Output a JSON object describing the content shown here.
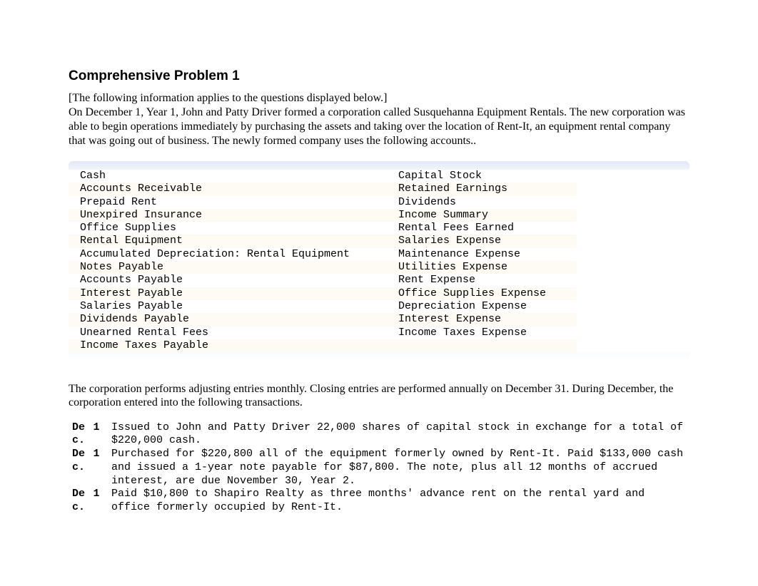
{
  "title": "Comprehensive Problem 1",
  "intro_bracket": "[The following information applies to the questions displayed below.]",
  "intro_body": "On December 1, Year 1, John and Patty Driver formed a corporation called Susquehanna Equipment Rentals. The new corporation was able to begin operations immediately by purchasing the assets and taking over the location of Rent-It, an equipment rental company that was going out of business. The newly formed company uses the following accounts..",
  "accounts": {
    "left": [
      "Cash",
      "Accounts Receivable",
      "Prepaid Rent",
      "Unexpired Insurance",
      "Office Supplies",
      "Rental Equipment",
      "Accumulated Depreciation: Rental Equipment",
      "Notes Payable",
      "Accounts Payable",
      "Interest Payable",
      "Salaries Payable",
      "Dividends Payable",
      "Unearned Rental Fees",
      "Income Taxes Payable"
    ],
    "right": [
      "Capital Stock",
      "Retained Earnings",
      "Dividends",
      "Income Summary",
      "Rental Fees Earned",
      "Salaries Expense",
      "Maintenance Expense",
      "Utilities Expense",
      "Rent Expense",
      "Office Supplies Expense",
      "Depreciation Expense",
      "Interest Expense",
      "Income Taxes Expense",
      ""
    ]
  },
  "mid_paragraph": "The corporation performs adjusting entries monthly. Closing entries are performed annually on December 31. During December, the corporation entered into the following transactions.",
  "transactions": [
    {
      "month_top": "De",
      "month_bottom": "c.",
      "day": "1",
      "desc": "Issued to John and Patty Driver 22,000 shares of capital stock in exchange for a total of $220,000 cash."
    },
    {
      "month_top": "De",
      "month_bottom": "c.",
      "day": "1",
      "desc": "Purchased for $220,800 all of the equipment formerly owned by Rent-It. Paid $133,000 cash and issued a 1-year note payable for $87,800. The note, plus all 12 months of accrued interest, are due November 30, Year 2."
    },
    {
      "month_top": "De",
      "month_bottom": "c.",
      "day": "1",
      "desc": "Paid $10,800 to Shapiro Realty as three months' advance rent on the rental yard and office formerly occupied by Rent-It."
    }
  ]
}
